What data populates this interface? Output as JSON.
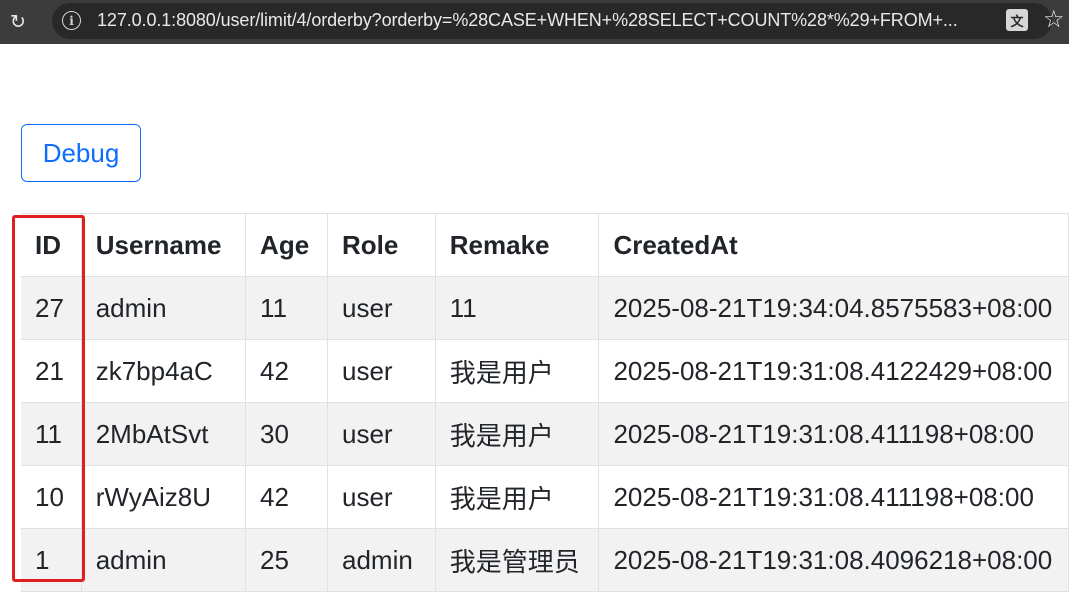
{
  "browser": {
    "url": "127.0.0.1:8080/user/limit/4/orderby?orderby=%28CASE+WHEN+%28SELECT+COUNT%28*%29+FROM+..."
  },
  "page": {
    "debug_label": "Debug"
  },
  "table": {
    "headers": [
      "ID",
      "Username",
      "Age",
      "Role",
      "Remake",
      "CreatedAt"
    ],
    "rows": [
      [
        "27",
        "admin",
        "11",
        "user",
        "11",
        "2025-08-21T19:34:04.8575583+08:00"
      ],
      [
        "21",
        "zk7bp4aC",
        "42",
        "user",
        "我是用户",
        "2025-08-21T19:31:08.4122429+08:00"
      ],
      [
        "11",
        "2MbAtSvt",
        "30",
        "user",
        "我是用户",
        "2025-08-21T19:31:08.411198+08:00"
      ],
      [
        "10",
        "rWyAiz8U",
        "42",
        "user",
        "我是用户",
        "2025-08-21T19:31:08.411198+08:00"
      ],
      [
        "1",
        "admin",
        "25",
        "admin",
        "我是管理员",
        "2025-08-21T19:31:08.4096218+08:00"
      ]
    ]
  },
  "colors": {
    "accent": "#0d6efd",
    "highlight": "#e02020"
  }
}
